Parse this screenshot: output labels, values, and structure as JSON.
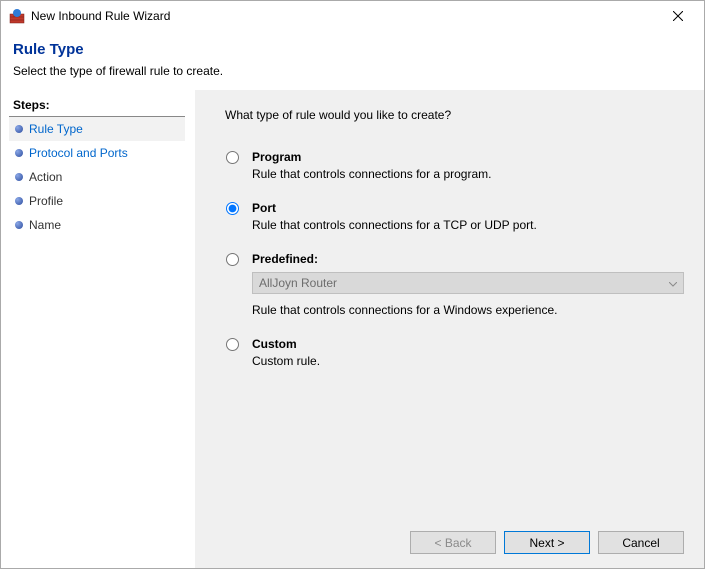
{
  "window": {
    "title": "New Inbound Rule Wizard"
  },
  "header": {
    "title": "Rule Type",
    "subtitle": "Select the type of firewall rule to create."
  },
  "sidebar": {
    "steps_label": "Steps:",
    "items": [
      {
        "label": "Rule Type"
      },
      {
        "label": "Protocol and Ports"
      },
      {
        "label": "Action"
      },
      {
        "label": "Profile"
      },
      {
        "label": "Name"
      }
    ]
  },
  "main": {
    "prompt": "What type of rule would you like to create?",
    "options": {
      "program": {
        "label": "Program",
        "desc": "Rule that controls connections for a program."
      },
      "port": {
        "label": "Port",
        "desc": "Rule that controls connections for a TCP or UDP port."
      },
      "predefined": {
        "label": "Predefined:",
        "dropdown_value": "AllJoyn Router",
        "desc": "Rule that controls connections for a Windows experience."
      },
      "custom": {
        "label": "Custom",
        "desc": "Custom rule."
      }
    },
    "selected": "port"
  },
  "footer": {
    "back": "< Back",
    "next": "Next >",
    "cancel": "Cancel"
  }
}
